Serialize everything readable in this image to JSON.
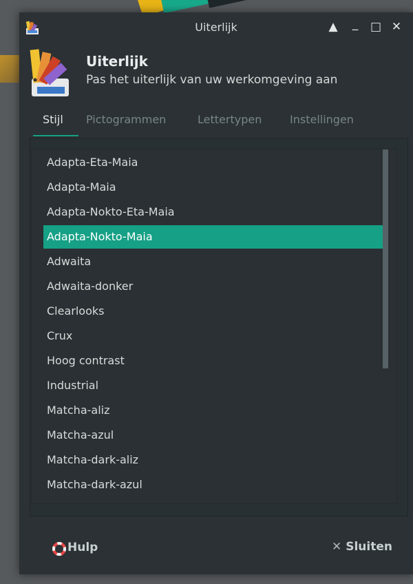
{
  "window": {
    "title": "Uiterlijk",
    "controls": {
      "shade": "▲",
      "minimize": "_",
      "maximize": "□",
      "close": "✕"
    }
  },
  "header": {
    "title": "Uiterlijk",
    "subtitle": "Pas het uiterlijk van uw werkomgeving aan"
  },
  "tabs": [
    {
      "label": "Stijl",
      "active": true
    },
    {
      "label": "Pictogrammen",
      "active": false
    },
    {
      "label": "Lettertypen",
      "active": false
    },
    {
      "label": "Instellingen",
      "active": false
    }
  ],
  "themes": [
    "Adapta-Eta-Maia",
    "Adapta-Maia",
    "Adapta-Nokto-Eta-Maia",
    "Adapta-Nokto-Maia",
    "Adwaita",
    "Adwaita-donker",
    "Clearlooks",
    "Crux",
    "Hoog contrast",
    "Industrial",
    "Matcha-aliz",
    "Matcha-azul",
    "Matcha-dark-aliz",
    "Matcha-dark-azul"
  ],
  "selected_theme": "Adapta-Nokto-Maia",
  "footer": {
    "help_label": "Hulp",
    "close_label": "Sluiten",
    "close_symbol": "✕"
  },
  "colors": {
    "accent": "#16a085",
    "window_bg": "#2b3134",
    "text": "#d7dbdc"
  },
  "icons": {
    "app": "appearance-palette-icon",
    "help": "lifebuoy-icon",
    "close": "close-icon"
  }
}
